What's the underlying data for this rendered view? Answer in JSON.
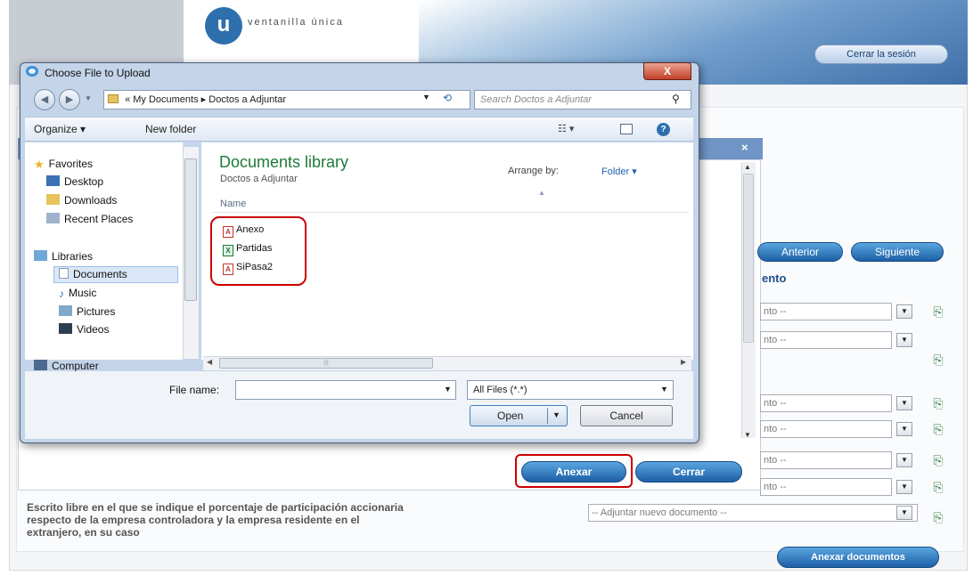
{
  "header": {
    "logo_letter": "u",
    "logo_text": "ventanilla única",
    "logout_label": "Cerrar la sesión"
  },
  "nav_buttons": {
    "previous": "Anterior",
    "next": "Siguiente"
  },
  "section_title": "ento",
  "doc_selects": [
    "nto --",
    "nto --",
    "nto --",
    "nto --",
    "nto --",
    "nto --"
  ],
  "modal_buttons": {
    "attach": "Anexar",
    "close": "Cerrar"
  },
  "escrito_text": "Escrito libre en el que se indique el porcentaje de participación accionaria\nrespecto de la empresa controladora y la empresa residente en el\nextranjero, en su caso",
  "new_doc_select": "-- Adjuntar nuevo documento --",
  "attach_documents_label": "Anexar documentos",
  "dialog": {
    "title": "Choose File to Upload",
    "close_label": "X",
    "address": {
      "root": "«",
      "segments": [
        "My Documents",
        "Doctos a Adjuntar"
      ]
    },
    "search_placeholder": "Search Doctos a Adjuntar",
    "toolbar": {
      "organize": "Organize ▾",
      "new_folder": "New folder"
    },
    "nav": {
      "favorites": "Favorites",
      "desktop": "Desktop",
      "downloads": "Downloads",
      "recent": "Recent Places",
      "libraries": "Libraries",
      "documents": "Documents",
      "music": "Music",
      "pictures": "Pictures",
      "videos": "Videos",
      "computer": "Computer"
    },
    "library_title": "Documents library",
    "library_subtitle": "Doctos a Adjuntar",
    "arrange_by_label": "Arrange by:",
    "arrange_by_value": "Folder ▾",
    "column_name": "Name",
    "files": [
      {
        "name": "Anexo",
        "type": "pdf"
      },
      {
        "name": "Partidas",
        "type": "xls"
      },
      {
        "name": "SiPasa2",
        "type": "pdf"
      }
    ],
    "file_name_label": "File name:",
    "file_name_value": "",
    "file_type": "All Files (*.*)",
    "open_label": "Open",
    "cancel_label": "Cancel"
  },
  "colors": {
    "accent": "#1d5fa6",
    "highlight": "#cc0000",
    "library_green": "#1e7a3a"
  }
}
